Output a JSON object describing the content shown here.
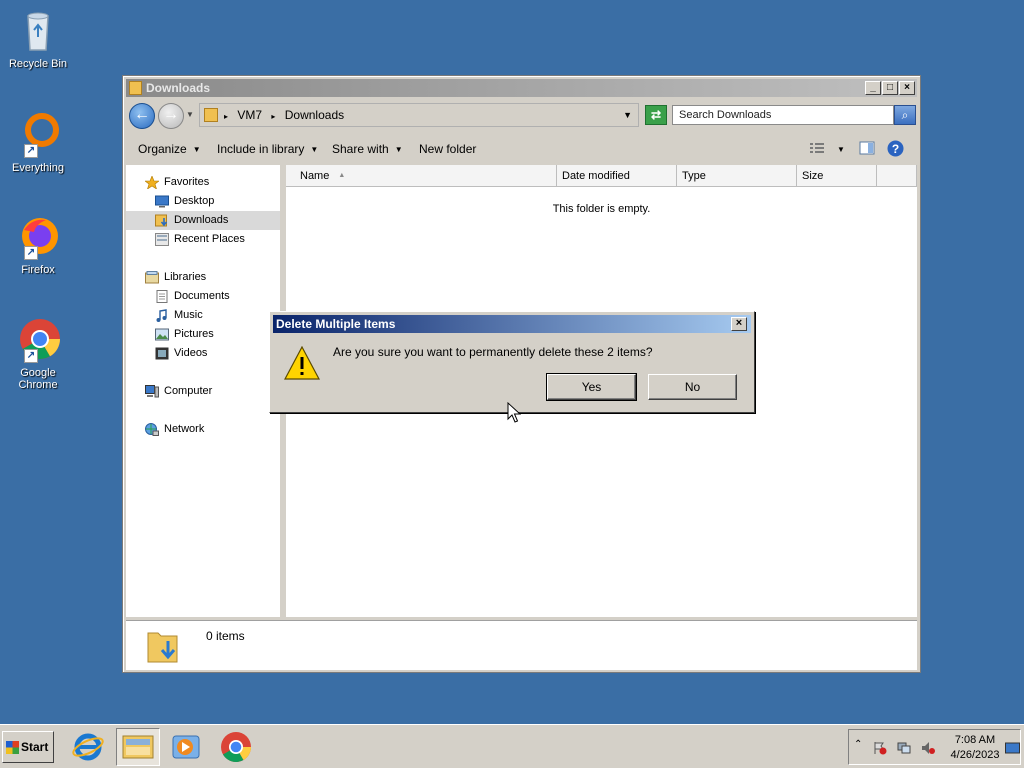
{
  "desktop": {
    "icons": [
      {
        "label": "Recycle Bin"
      },
      {
        "label": "Everything"
      },
      {
        "label": "Firefox"
      },
      {
        "label": "Google Chrome"
      }
    ]
  },
  "window": {
    "title": "Downloads",
    "address": {
      "segments": [
        "VM7",
        "Downloads"
      ]
    },
    "search_placeholder": "Search Downloads",
    "toolbar": {
      "organize": "Organize",
      "include_in_library": "Include in library",
      "share_with": "Share with",
      "new_folder": "New folder"
    },
    "nav": {
      "favorites": "Favorites",
      "desktop": "Desktop",
      "downloads": "Downloads",
      "recent_places": "Recent Places",
      "libraries": "Libraries",
      "documents": "Documents",
      "music": "Music",
      "pictures": "Pictures",
      "videos": "Videos",
      "computer": "Computer",
      "network": "Network",
      "selected": "Downloads"
    },
    "columns": {
      "name": "Name",
      "date_modified": "Date modified",
      "type": "Type",
      "size": "Size"
    },
    "empty_message": "This folder is empty.",
    "status": {
      "item_count": "0 items"
    }
  },
  "dialog": {
    "title": "Delete Multiple Items",
    "message": "Are you sure you want to permanently delete these 2 items?",
    "yes": "Yes",
    "no": "No"
  },
  "taskbar": {
    "start": "Start",
    "apps": [
      "internet-explorer",
      "windows-explorer",
      "media-player",
      "google-chrome"
    ],
    "clock": {
      "time": "7:08 AM",
      "date": "4/26/2023"
    }
  },
  "colors": {
    "desktop": "#3a6ea5",
    "dialog_title": "#0a246a",
    "chrome_face": "#d4d0c8"
  }
}
